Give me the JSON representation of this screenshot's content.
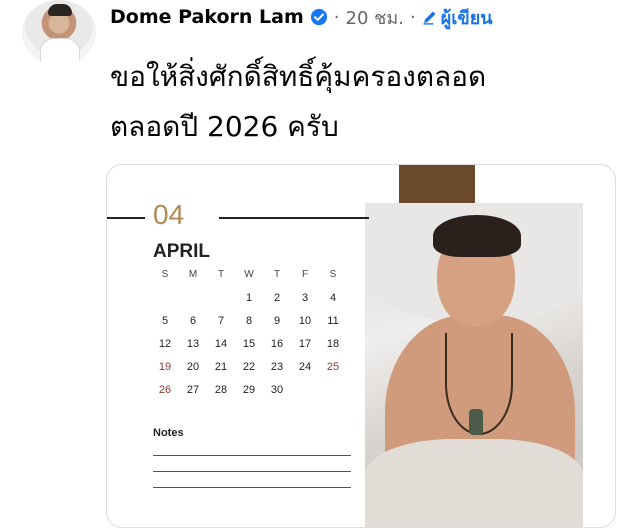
{
  "author": {
    "name": "Dome Pakorn Lam",
    "time": "20 ชม.",
    "role_label": "ผู้เขียน"
  },
  "post": {
    "line1": "ขอให้สิ่งศักดิ์สิทธิ์คุ้มครองตลอด",
    "line2": "ตลอดปี 2026 ครับ"
  },
  "calendar": {
    "month_number": "04",
    "month_name": "APRIL",
    "weekdays": [
      "S",
      "M",
      "T",
      "W",
      "T",
      "F",
      "S"
    ],
    "weeks": [
      [
        "",
        "",
        "",
        "1",
        "2",
        "3",
        "4"
      ],
      [
        "5",
        "6",
        "7",
        "8",
        "9",
        "10",
        "11"
      ],
      [
        "12",
        "13",
        "14",
        "15",
        "16",
        "17",
        "18"
      ],
      [
        "19",
        "20",
        "21",
        "22",
        "23",
        "24",
        "25"
      ],
      [
        "26",
        "27",
        "28",
        "29",
        "30",
        "",
        ""
      ]
    ],
    "notes_label": "Notes"
  },
  "colors": {
    "accent_gold": "#b08a55",
    "band_brown": "#6b4a2b",
    "link_blue": "#1b74e4",
    "verified_blue": "#1877f2"
  }
}
